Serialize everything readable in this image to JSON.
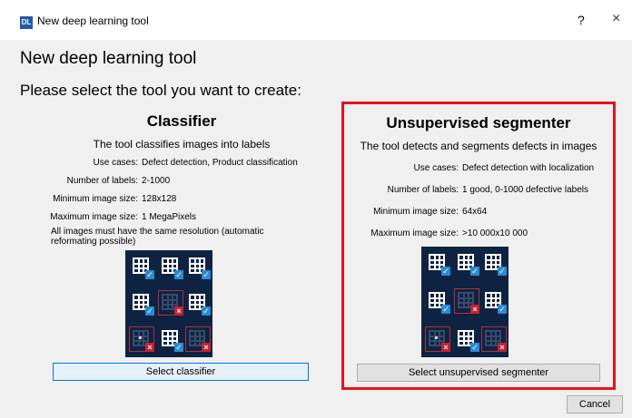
{
  "window": {
    "app_icon_text": "DL",
    "title": "New deep learning tool",
    "help_label": "?",
    "close_label": "×"
  },
  "dialog": {
    "heading": "New deep learning tool",
    "prompt": "Please select the tool you want to create:"
  },
  "classifier": {
    "title": "Classifier",
    "description": "The tool classifies images into labels",
    "rows": [
      {
        "key": "Use cases:",
        "value": "Defect detection, Product classification"
      },
      {
        "key": "Number of labels:",
        "value": "2-1000"
      },
      {
        "key": "Minimum image size:",
        "value": "128x128"
      },
      {
        "key": "Maximum image size:",
        "value": "1 MegaPixels"
      }
    ],
    "note": "All images must have the same resolution (automatic reformating possible)",
    "button_label": "Select classifier"
  },
  "segmenter": {
    "title": "Unsupervised segmenter",
    "description": "The tool detects and segments defects in images",
    "rows": [
      {
        "key": "Use cases:",
        "value": "Defect detection with localization"
      },
      {
        "key": "Number of labels:",
        "value": "1 good, 0-1000 defective labels"
      },
      {
        "key": "Minimum image size:",
        "value": "64x64"
      },
      {
        "key": "Maximum image size:",
        "value": ">10 000x10 000"
      }
    ],
    "button_label": "Select unsupervised segmenter"
  },
  "footer": {
    "cancel_label": "Cancel"
  },
  "colors": {
    "highlight_border": "#e3151c",
    "image_background": "#0e2341",
    "ok_mark": "#2a8ad4",
    "defect_mark": "#c8202f",
    "focus_border": "#0078d7"
  },
  "icons": {
    "ok": "checkmark-icon",
    "defect": "x-mark-icon"
  }
}
